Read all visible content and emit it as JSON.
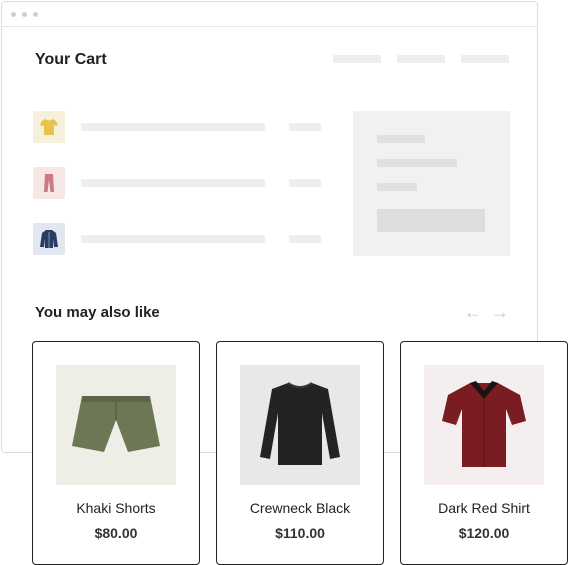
{
  "cart": {
    "title": "Your Cart",
    "items": [
      {
        "icon": "yellow-tshirt-icon",
        "bg": "#f6efd9"
      },
      {
        "icon": "pink-pants-icon",
        "bg": "#f7e6e6"
      },
      {
        "icon": "navy-jacket-icon",
        "bg": "#e2e6ef"
      }
    ]
  },
  "recommendations": {
    "title": "You may also like",
    "prev_icon": "arrow-left-icon",
    "next_icon": "arrow-right-icon",
    "prev_glyph": "←",
    "next_glyph": "→",
    "products": [
      {
        "name": "Khaki Shorts",
        "price": "$80.00",
        "icon": "khaki-shorts-icon",
        "bg": "#eeeee6"
      },
      {
        "name": "Crewneck Black",
        "price": "$110.00",
        "icon": "black-crewneck-icon",
        "bg": "#e8e8e8"
      },
      {
        "name": "Dark Red Shirt",
        "price": "$120.00",
        "icon": "dark-red-shirt-icon",
        "bg": "#f5eeee"
      }
    ]
  },
  "colors": {
    "border": "#222222",
    "placeholder": "#eeeeee",
    "muted_arrow": "#c8c8c8"
  }
}
